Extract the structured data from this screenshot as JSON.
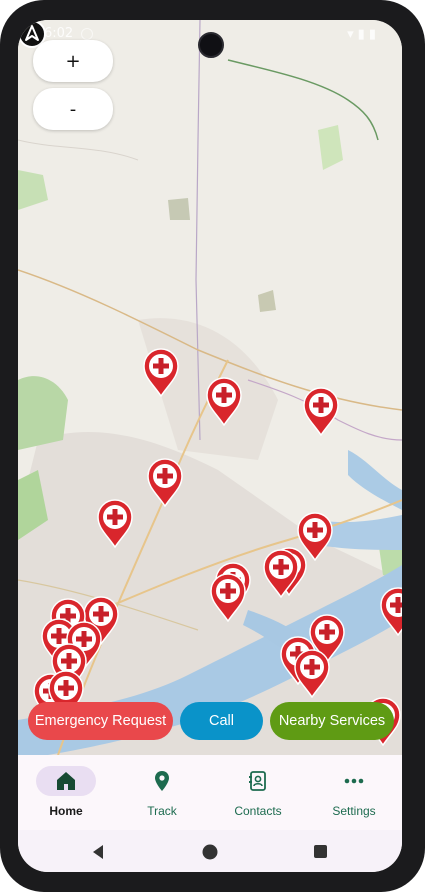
{
  "status_bar": {
    "time": "6:02"
  },
  "map": {
    "zoom_in_label": "+",
    "zoom_out_label": "-",
    "marker_icon": "red-cross-pin-icon",
    "user_marker_icon": "navigation-arrow-icon"
  },
  "actions": {
    "emergency_label": "Emergency Request",
    "call_label": "Call",
    "nearby_label": "Nearby Services",
    "colors": {
      "emergency": "#e9484b",
      "call": "#0a93c9",
      "nearby": "#5f9b14"
    }
  },
  "bottom_nav": {
    "items": [
      {
        "label": "Home",
        "icon": "home-icon",
        "active": true
      },
      {
        "label": "Track",
        "icon": "location-pin-icon",
        "active": false
      },
      {
        "label": "Contacts",
        "icon": "contacts-icon",
        "active": false
      },
      {
        "label": "Settings",
        "icon": "more-dots-icon",
        "active": false
      }
    ],
    "accent": "#1d6b4f"
  },
  "system_nav": {
    "icons": [
      "back-icon",
      "home-circle-icon",
      "recents-icon"
    ]
  }
}
